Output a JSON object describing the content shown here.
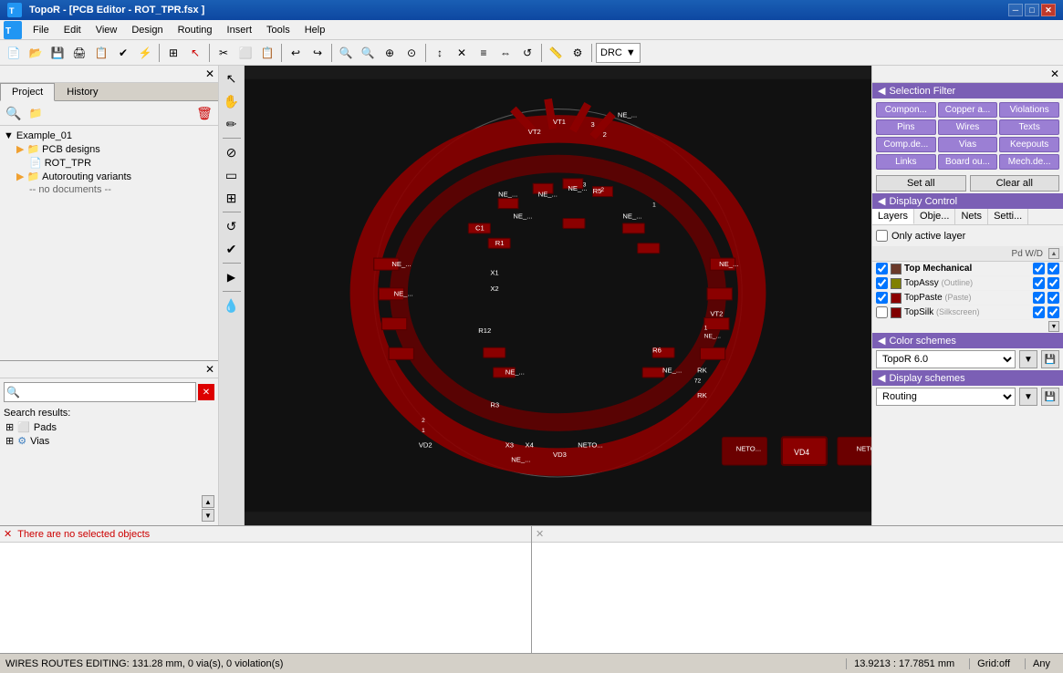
{
  "titleBar": {
    "title": "TopoR - [PCB Editor - ROT_TPR.fsx ]",
    "minBtn": "─",
    "maxBtn": "□",
    "closeBtn": "✕"
  },
  "menuBar": {
    "items": [
      "File",
      "Edit",
      "View",
      "Design",
      "Routing",
      "Insert",
      "Tools",
      "Help"
    ]
  },
  "toolbar": {
    "drc": "DRC"
  },
  "leftPanel": {
    "tabs": [
      "Project",
      "History"
    ],
    "activeTab": "Project",
    "tree": {
      "root": "Example_01",
      "children": [
        {
          "label": "PCB designs",
          "type": "folder",
          "children": [
            {
              "label": "ROT_TPR",
              "type": "doc"
            }
          ]
        },
        {
          "label": "Autorouting variants",
          "type": "folder",
          "children": [
            {
              "label": "-- no documents --",
              "type": "text"
            }
          ]
        }
      ]
    },
    "searchPlaceholder": "",
    "searchLabel": "Search results:",
    "searchResults": [
      {
        "label": "Pads",
        "icon": "+"
      },
      {
        "label": "Vias",
        "icon": "+"
      }
    ]
  },
  "rightPanel": {
    "selectionFilter": {
      "title": "Selection Filter",
      "buttons": [
        "Compon...",
        "Copper a...",
        "Violations",
        "Pins",
        "Wires",
        "Texts",
        "Comp.de...",
        "Vias",
        "Keepouts",
        "Links",
        "Board ou...",
        "Mech.de..."
      ],
      "setAll": "Set all",
      "clearAll": "Clear all"
    },
    "displayControl": {
      "title": "Display Control",
      "tabs": [
        "Layers",
        "Obje...",
        "Nets",
        "Setti..."
      ],
      "activeTab": "Layers",
      "onlyActiveLayer": "Only active layer",
      "pdwLabel": "Pd W/D",
      "layers": [
        {
          "name": "Top Mechanical",
          "color": "#8B4513",
          "visible": true,
          "bold": true
        },
        {
          "name": "TopAssy",
          "subLabel": "(Outline)",
          "color": "#808000",
          "visible": true
        },
        {
          "name": "TopPaste",
          "subLabel": "(Paste)",
          "color": "#8B0000",
          "visible": true
        },
        {
          "name": "TopSilk",
          "subLabel": "(Silkscreen)",
          "color": "#800000",
          "visible": true
        }
      ]
    },
    "colorSchemes": {
      "title": "Color schemes",
      "selected": "TopoR 6.0",
      "options": [
        "TopoR 6.0"
      ]
    },
    "displaySchemes": {
      "title": "Display schemes",
      "selected": "Routing",
      "options": [
        "Routing"
      ]
    }
  },
  "bottomLeft": {
    "closeLabel": "✕",
    "message": "There are no selected objects"
  },
  "bottomRight": {
    "closeLabel": "✕",
    "message": ""
  },
  "statusBar": {
    "main": "WIRES ROUTES EDITING: 131.28 mm, 0 via(s), 0 violation(s)",
    "coord": "13.9213 : 17.7851 mm",
    "grid": "Grid:off",
    "any": "Any"
  },
  "leftToolbar": {
    "buttons": [
      "↖",
      "✋",
      "✏",
      "⊘",
      "▭",
      "⊞",
      "↺",
      "✔",
      "▶",
      "💧"
    ]
  }
}
